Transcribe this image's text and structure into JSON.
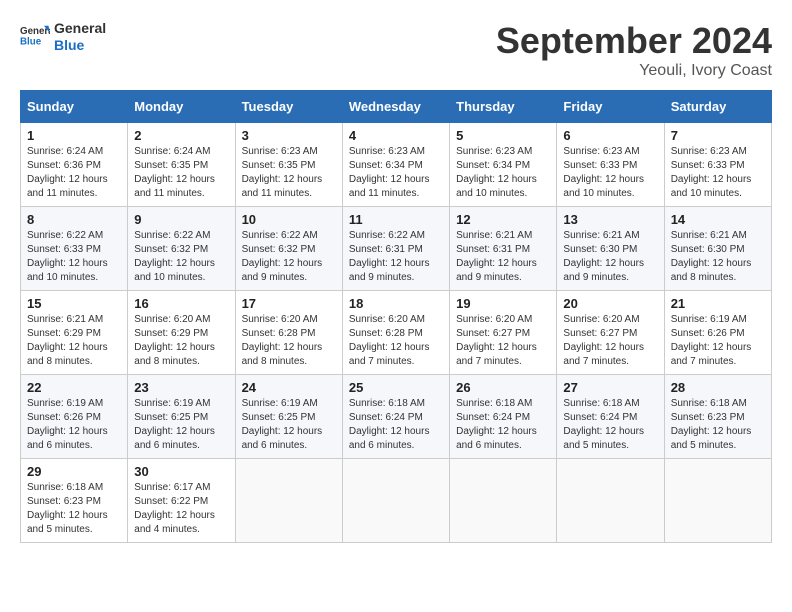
{
  "header": {
    "logo_text_general": "General",
    "logo_text_blue": "Blue",
    "month_title": "September 2024",
    "location": "Yeouli, Ivory Coast"
  },
  "calendar": {
    "days_of_week": [
      "Sunday",
      "Monday",
      "Tuesday",
      "Wednesday",
      "Thursday",
      "Friday",
      "Saturday"
    ],
    "weeks": [
      [
        {
          "day": "1",
          "sunrise": "6:24 AM",
          "sunset": "6:36 PM",
          "daylight": "12 hours and 11 minutes."
        },
        {
          "day": "2",
          "sunrise": "6:24 AM",
          "sunset": "6:35 PM",
          "daylight": "12 hours and 11 minutes."
        },
        {
          "day": "3",
          "sunrise": "6:23 AM",
          "sunset": "6:35 PM",
          "daylight": "12 hours and 11 minutes."
        },
        {
          "day": "4",
          "sunrise": "6:23 AM",
          "sunset": "6:34 PM",
          "daylight": "12 hours and 11 minutes."
        },
        {
          "day": "5",
          "sunrise": "6:23 AM",
          "sunset": "6:34 PM",
          "daylight": "12 hours and 10 minutes."
        },
        {
          "day": "6",
          "sunrise": "6:23 AM",
          "sunset": "6:33 PM",
          "daylight": "12 hours and 10 minutes."
        },
        {
          "day": "7",
          "sunrise": "6:23 AM",
          "sunset": "6:33 PM",
          "daylight": "12 hours and 10 minutes."
        }
      ],
      [
        {
          "day": "8",
          "sunrise": "6:22 AM",
          "sunset": "6:33 PM",
          "daylight": "12 hours and 10 minutes."
        },
        {
          "day": "9",
          "sunrise": "6:22 AM",
          "sunset": "6:32 PM",
          "daylight": "12 hours and 10 minutes."
        },
        {
          "day": "10",
          "sunrise": "6:22 AM",
          "sunset": "6:32 PM",
          "daylight": "12 hours and 9 minutes."
        },
        {
          "day": "11",
          "sunrise": "6:22 AM",
          "sunset": "6:31 PM",
          "daylight": "12 hours and 9 minutes."
        },
        {
          "day": "12",
          "sunrise": "6:21 AM",
          "sunset": "6:31 PM",
          "daylight": "12 hours and 9 minutes."
        },
        {
          "day": "13",
          "sunrise": "6:21 AM",
          "sunset": "6:30 PM",
          "daylight": "12 hours and 9 minutes."
        },
        {
          "day": "14",
          "sunrise": "6:21 AM",
          "sunset": "6:30 PM",
          "daylight": "12 hours and 8 minutes."
        }
      ],
      [
        {
          "day": "15",
          "sunrise": "6:21 AM",
          "sunset": "6:29 PM",
          "daylight": "12 hours and 8 minutes."
        },
        {
          "day": "16",
          "sunrise": "6:20 AM",
          "sunset": "6:29 PM",
          "daylight": "12 hours and 8 minutes."
        },
        {
          "day": "17",
          "sunrise": "6:20 AM",
          "sunset": "6:28 PM",
          "daylight": "12 hours and 8 minutes."
        },
        {
          "day": "18",
          "sunrise": "6:20 AM",
          "sunset": "6:28 PM",
          "daylight": "12 hours and 7 minutes."
        },
        {
          "day": "19",
          "sunrise": "6:20 AM",
          "sunset": "6:27 PM",
          "daylight": "12 hours and 7 minutes."
        },
        {
          "day": "20",
          "sunrise": "6:20 AM",
          "sunset": "6:27 PM",
          "daylight": "12 hours and 7 minutes."
        },
        {
          "day": "21",
          "sunrise": "6:19 AM",
          "sunset": "6:26 PM",
          "daylight": "12 hours and 7 minutes."
        }
      ],
      [
        {
          "day": "22",
          "sunrise": "6:19 AM",
          "sunset": "6:26 PM",
          "daylight": "12 hours and 6 minutes."
        },
        {
          "day": "23",
          "sunrise": "6:19 AM",
          "sunset": "6:25 PM",
          "daylight": "12 hours and 6 minutes."
        },
        {
          "day": "24",
          "sunrise": "6:19 AM",
          "sunset": "6:25 PM",
          "daylight": "12 hours and 6 minutes."
        },
        {
          "day": "25",
          "sunrise": "6:18 AM",
          "sunset": "6:24 PM",
          "daylight": "12 hours and 6 minutes."
        },
        {
          "day": "26",
          "sunrise": "6:18 AM",
          "sunset": "6:24 PM",
          "daylight": "12 hours and 6 minutes."
        },
        {
          "day": "27",
          "sunrise": "6:18 AM",
          "sunset": "6:24 PM",
          "daylight": "12 hours and 5 minutes."
        },
        {
          "day": "28",
          "sunrise": "6:18 AM",
          "sunset": "6:23 PM",
          "daylight": "12 hours and 5 minutes."
        }
      ],
      [
        {
          "day": "29",
          "sunrise": "6:18 AM",
          "sunset": "6:23 PM",
          "daylight": "12 hours and 5 minutes."
        },
        {
          "day": "30",
          "sunrise": "6:17 AM",
          "sunset": "6:22 PM",
          "daylight": "12 hours and 4 minutes."
        },
        null,
        null,
        null,
        null,
        null
      ]
    ]
  }
}
